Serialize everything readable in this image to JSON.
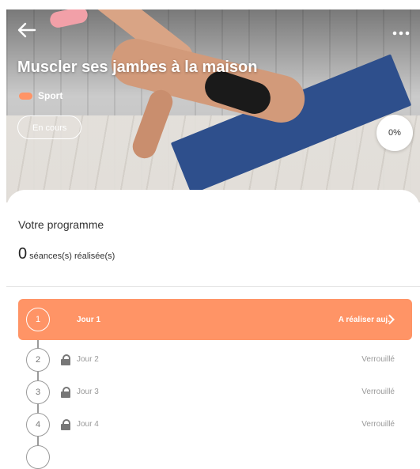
{
  "header": {
    "title": "Muscler ses jambes à la maison",
    "category": "Sport",
    "status_chip": "En cours",
    "progress": "0%",
    "back_icon": "arrow-left-icon",
    "more_icon": "more-horizontal-icon"
  },
  "program": {
    "section_title": "Votre programme",
    "completed_count": "0",
    "completed_label": "séances(s) réalisée(s)"
  },
  "days": [
    {
      "number": "1",
      "label": "Jour 1",
      "status": "A réaliser auj.",
      "active": true,
      "locked": false
    },
    {
      "number": "2",
      "label": "Jour 2",
      "status": "Verrouillé",
      "active": false,
      "locked": true
    },
    {
      "number": "3",
      "label": "Jour 3",
      "status": "Verrouillé",
      "active": false,
      "locked": true
    },
    {
      "number": "4",
      "label": "Jour 4",
      "status": "Verrouillé",
      "active": false,
      "locked": true
    }
  ],
  "colors": {
    "accent": "#ff9466",
    "text": "#333333",
    "muted": "#999999"
  }
}
